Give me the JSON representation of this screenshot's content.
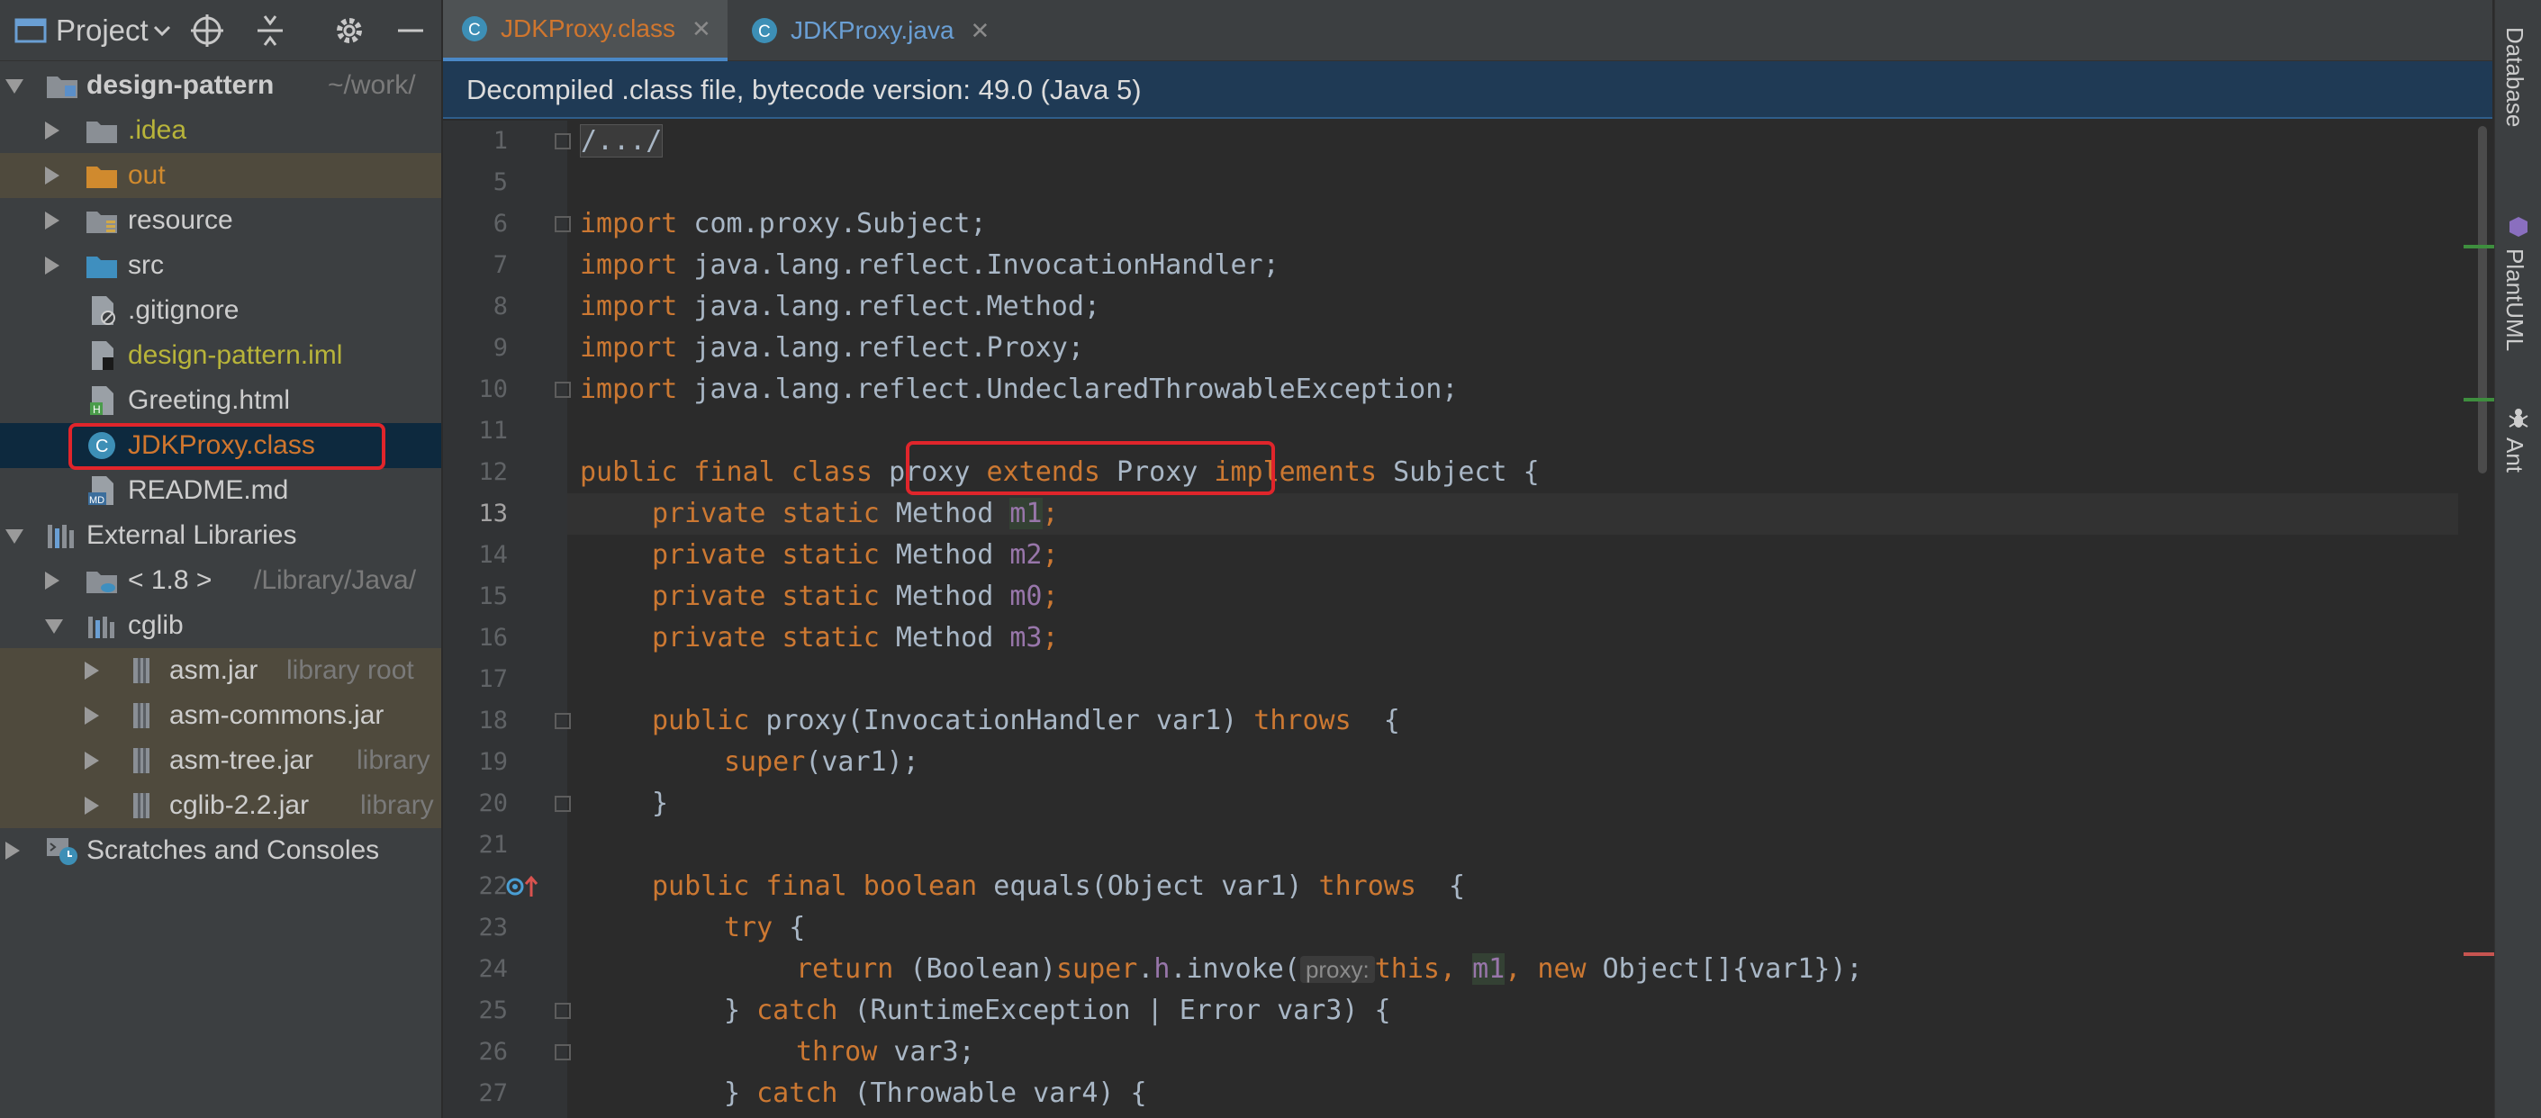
{
  "project_panel": {
    "title": "Project",
    "tree": [
      {
        "label": "design-pattern",
        "hint": "~/work/",
        "icon": "module-folder-icon",
        "color": "#cdcdcd",
        "bold": true
      },
      {
        "label": ".idea",
        "icon": "folder-icon",
        "color": "#b8b43a"
      },
      {
        "label": "out",
        "icon": "folder-orange-icon",
        "color": "#d08a2e"
      },
      {
        "label": "resource",
        "icon": "resource-folder-icon",
        "color": "#cdcdcd"
      },
      {
        "label": "src",
        "icon": "source-folder-icon",
        "color": "#cdcdcd"
      },
      {
        "label": ".gitignore",
        "icon": "ignore-file-icon",
        "color": "#cdcdcd"
      },
      {
        "label": "design-pattern.iml",
        "icon": "iml-file-icon",
        "color": "#b8b43a"
      },
      {
        "label": "Greeting.html",
        "icon": "html-file-icon",
        "color": "#cdcdcd"
      },
      {
        "label": "JDKProxy.class",
        "icon": "class-file-icon",
        "color": "#d0762e"
      },
      {
        "label": "README.md",
        "icon": "markdown-file-icon",
        "color": "#cdcdcd"
      },
      {
        "label": "External Libraries",
        "icon": "libraries-icon",
        "color": "#cdcdcd"
      },
      {
        "label": "< 1.8 >",
        "hint": "/Library/Java/",
        "icon": "jdk-folder-icon",
        "color": "#cdcdcd"
      },
      {
        "label": "cglib",
        "icon": "library-icon",
        "color": "#cdcdcd"
      },
      {
        "label": "asm.jar",
        "hint": "library root",
        "icon": "jar-icon",
        "color": "#cdcdcd"
      },
      {
        "label": "asm-commons.jar",
        "hint": "library",
        "icon": "jar-icon",
        "color": "#cdcdcd"
      },
      {
        "label": "asm-tree.jar",
        "hint": "library",
        "icon": "jar-icon",
        "color": "#cdcdcd"
      },
      {
        "label": "cglib-2.2.jar",
        "hint": "library",
        "icon": "jar-icon",
        "color": "#cdcdcd"
      },
      {
        "label": "Scratches and Consoles",
        "icon": "scratches-icon",
        "color": "#cdcdcd"
      }
    ]
  },
  "tabs": [
    {
      "label": "JDKProxy.class",
      "active": true,
      "color": "#d0762e"
    },
    {
      "label": "JDKProxy.java",
      "active": false,
      "color": "#6a9fd4"
    }
  ],
  "banner": "Decompiled .class file, bytecode version: 49.0 (Java 5)",
  "editor": {
    "line_numbers": [
      "1",
      "5",
      "6",
      "7",
      "8",
      "9",
      "10",
      "11",
      "12",
      "13",
      "14",
      "15",
      "16",
      "17",
      "18",
      "19",
      "20",
      "21",
      "22",
      "23",
      "24",
      "25",
      "26",
      "27"
    ],
    "lines": {
      "l1": "/.../",
      "l6a": "import",
      "l6b": " com.proxy.Subject;",
      "l7a": "import",
      "l7b": " java.lang.reflect.InvocationHandler;",
      "l8a": "import",
      "l8b": " java.lang.reflect.Method;",
      "l9a": "import",
      "l9b": " java.lang.reflect.Proxy;",
      "l10a": "import",
      "l10b": " java.lang.reflect.UndeclaredThrowableException;",
      "l12a": "public final class",
      "l12b": " proxy ",
      "l12c": "extends",
      "l12d": " Proxy ",
      "l12e": "implements",
      "l12f": " Subject {",
      "l13a": "private static",
      "l13b": " Method ",
      "l13c": "m1",
      "l13d": ";",
      "l14a": "private static",
      "l14b": " Method ",
      "l14c": "m2",
      "l14d": ";",
      "l15a": "private static",
      "l15b": " Method ",
      "l15c": "m0",
      "l15d": ";",
      "l16a": "private static",
      "l16b": " Method ",
      "l16c": "m3",
      "l16d": ";",
      "l18a": "public",
      "l18b": " proxy(InvocationHandler var1) ",
      "l18c": "throws",
      "l18d": "  {",
      "l19a": "super",
      "l19b": "(var1);",
      "l20": "}",
      "l22a": "public final boolean",
      "l22b": " equals(Object var1) ",
      "l22c": "throws",
      "l22d": "  {",
      "l23a": "try",
      "l23b": " {",
      "l24a": "return",
      "l24b": " (Boolean)",
      "l24c": "super",
      "l24d": ".",
      "l24e": "h",
      "l24f": ".invoke(",
      "l24hint": "proxy:",
      "l24g": "this",
      "l24h": ", ",
      "l24i": "m1",
      "l24j": ", ",
      "l24k": "new",
      "l24l": " Object[]{var1});",
      "l25a": "} ",
      "l25b": "catch",
      "l25c": " (RuntimeException | Error var3) {",
      "l26a": "throw",
      "l26b": " var3;",
      "l27a": "} ",
      "l27b": "catch",
      "l27c": " (Throwable var4) {"
    }
  },
  "right_tools": [
    {
      "label": "Database"
    },
    {
      "label": "PlantUML"
    },
    {
      "label": "Ant"
    }
  ]
}
